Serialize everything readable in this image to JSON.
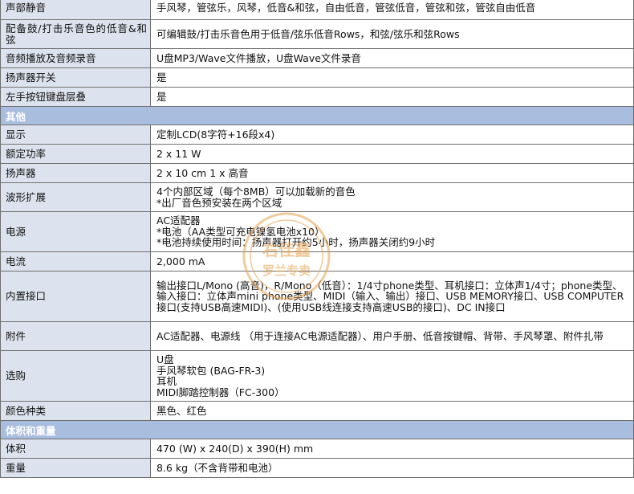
{
  "rows_top": [
    {
      "label": "声部静音",
      "value": [
        "手风琴，管弦乐，风琴，低音&和弦，自由低音，管弦低音，管弦和弦，管弦自由低音"
      ]
    },
    {
      "label": "配备鼓/打击乐音色的低音&和弦",
      "value": [
        "可编辑鼓/打击乐音色用于低音/弦乐低音Rows，和弦/弦乐和弦Rows"
      ]
    },
    {
      "label": "音频播放及音频录音",
      "value": [
        "U盘MP3/Wave文件播放，U盘Wave文件录音"
      ]
    },
    {
      "label": "扬声器开关",
      "value": [
        "是"
      ]
    },
    {
      "label": "左手按钮键盘层叠",
      "value": [
        "是"
      ]
    }
  ],
  "section_other": "其他",
  "rows_other": [
    {
      "label": "显示",
      "value": [
        "定制LCD(8字符+16段x4)"
      ]
    },
    {
      "label": "额定功率",
      "value": [
        "2 x 11 W"
      ]
    },
    {
      "label": "扬声器",
      "value": [
        "2 x 10 cm   1 x 高音"
      ]
    },
    {
      "label": "波形扩展",
      "value": [
        "4个内部区域（每个8MB）可以加载新的音色",
        "*出厂音色预安装在两个区域"
      ]
    },
    {
      "label": "电源",
      "value": [
        "AC适配器",
        "*电池（AA类型可充电镍氢电池x10）",
        "*电池持续使用时间：扬声器打开约5小时，扬声器关闭约9小时"
      ]
    },
    {
      "label": "电流",
      "value": [
        "2,000 mA"
      ]
    },
    {
      "label": "内置接口",
      "value": [
        "输出接口L/Mono          (高音)，R/Mono（低音）：1/4寸phone类型、耳机接口：立体声1/4寸；phone类型、输入接口：立体声mini   phone类型、MIDI（输入、输出）接口、USB   MEMORY接口、USB   COMPUTER接口(支持USB高速MIDI)、(使用USB线连接支持高速USB的接口)、DC IN接口"
      ]
    },
    {
      "label": "附件",
      "value": [
        "AC适配器、电源线  （用于连接AC电源适配器）、用户手册、低音按键帽、背带、手风琴罩、附件扎带"
      ]
    },
    {
      "label": "选购",
      "value": [
        "U盘",
        "手风琴软包 (BAG-FR-3)",
        "耳机",
        "MIDI脚踏控制器（FC-300）"
      ]
    },
    {
      "label": "颜色种类",
      "value": [
        "黑色、红色"
      ]
    }
  ],
  "section_size": "体积和重量",
  "rows_size": [
    {
      "label": "体积",
      "value": [
        "470 (W) x 240(D) x 390(H) mm"
      ]
    },
    {
      "label": "重量",
      "value": [
        "8.6 kg（不含背带和电池）"
      ]
    }
  ],
  "stamp": {
    "lines": [
      "右佳鑫",
      "罗兰专卖"
    ]
  },
  "colors": {
    "label_bg": "#dde3ee",
    "section_bg": "#a9bedf",
    "border": "#6f6f6f",
    "stamp": "#e7a24a"
  }
}
